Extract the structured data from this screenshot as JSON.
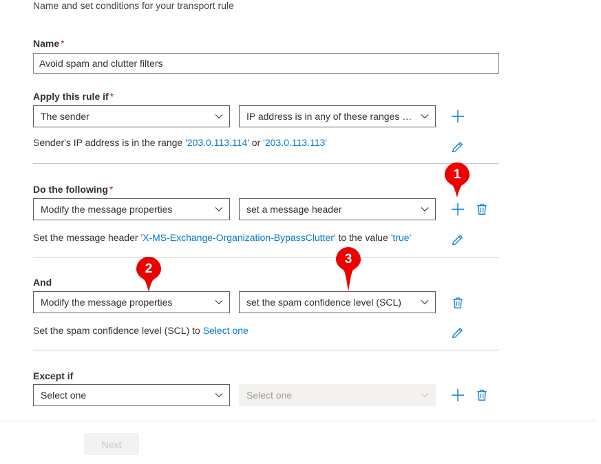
{
  "panel": {
    "subtitle": "Name and set conditions for your transport rule"
  },
  "name_field": {
    "label": "Name",
    "required_marker": "*",
    "value": "Avoid spam and clutter filters"
  },
  "conditions": {
    "label": "Apply this rule if",
    "required_marker": "*",
    "subject_dropdown": "The sender",
    "predicate_dropdown": "IP address is in any of these ranges or ...",
    "description": {
      "prefix": "Sender's IP address is in the range ",
      "value_1": "'203.0.113.114'",
      "joiner": " or ",
      "value_2": "'203.0.113.113'"
    },
    "add_label": "Add condition",
    "edit_label": "Edit condition"
  },
  "actions": {
    "label": "Do the following",
    "required_marker": "*",
    "subject_dropdown": "Modify the message properties",
    "predicate_dropdown": "set a message header",
    "description": {
      "prefix": "Set the message header ",
      "header_name": "'X-MS-Exchange-Organization-BypassClutter'",
      "middle": " to the value ",
      "header_value": "'true'"
    },
    "add_label": "Add action",
    "delete_label": "Delete action",
    "edit_label": "Edit action"
  },
  "and_action": {
    "label": "And",
    "subject_dropdown": "Modify the message properties",
    "predicate_dropdown": "set the spam confidence level (SCL)",
    "description": {
      "prefix": "Set the spam confidence level (SCL) to ",
      "link": "Select one"
    },
    "delete_label": "Delete action",
    "edit_label": "Edit action"
  },
  "exceptions": {
    "label": "Except if",
    "subject_dropdown": "Select one",
    "predicate_dropdown": "Select one",
    "add_label": "Add exception",
    "delete_label": "Delete exception"
  },
  "footer": {
    "next_label": "Next"
  },
  "callouts": [
    {
      "number": "1"
    },
    {
      "number": "2"
    },
    {
      "number": "3"
    }
  ],
  "colors": {
    "accent": "#0078d4",
    "callout_red": "#ee0000",
    "required_red": "#a4262c",
    "border": "#605e5c",
    "divider": "#c8c6c4",
    "disabled_bg": "#f3f2f1",
    "disabled_text": "#a19f9d"
  }
}
